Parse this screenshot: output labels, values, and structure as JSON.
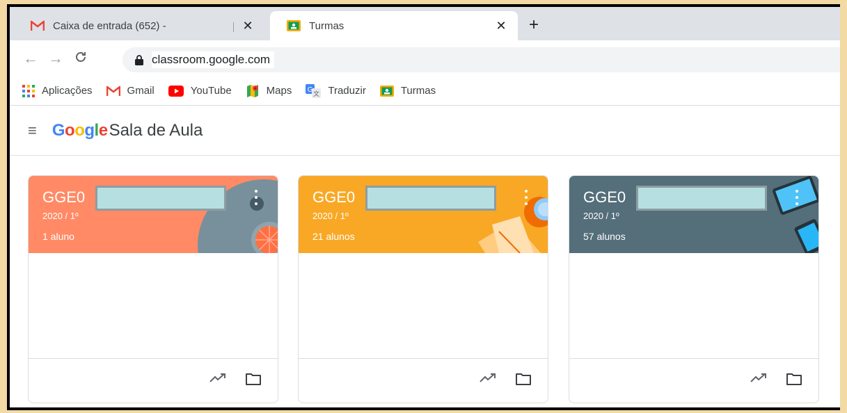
{
  "tabs": [
    {
      "title": "Caixa de entrada (652) -",
      "close": "✕",
      "favicon": "gmail-icon"
    },
    {
      "title": "Turmas",
      "close": "✕",
      "favicon": "classroom-icon"
    }
  ],
  "newtab": "+",
  "toolbar": {
    "back": "←",
    "forward": "→",
    "reload": "C",
    "url": "classroom.google.com"
  },
  "bookmarks": [
    {
      "label": "Aplicações",
      "icon": "apps-grid-icon"
    },
    {
      "label": "Gmail",
      "icon": "gmail-icon"
    },
    {
      "label": "YouTube",
      "icon": "youtube-icon"
    },
    {
      "label": "Maps",
      "icon": "maps-icon"
    },
    {
      "label": "Traduzir",
      "icon": "translate-icon"
    },
    {
      "label": "Turmas",
      "icon": "classroom-icon"
    }
  ],
  "header": {
    "menu": "≡",
    "logo": [
      {
        "ch": "G",
        "color": "#4285f4"
      },
      {
        "ch": "o",
        "color": "#ea4335"
      },
      {
        "ch": "o",
        "color": "#fbbc05"
      },
      {
        "ch": "g",
        "color": "#4285f4"
      },
      {
        "ch": "l",
        "color": "#34a853"
      },
      {
        "ch": "e",
        "color": "#ea4335"
      }
    ],
    "app_name": "Sala de Aula"
  },
  "cards": [
    {
      "name": "GGE0",
      "section": "2020 / 1º",
      "count": "1 aluno",
      "color": "#ff8a65"
    },
    {
      "name": "GGE0",
      "section": "2020 / 1º",
      "count": "21 alunos",
      "color": "#f9a825"
    },
    {
      "name": "GGE0",
      "section": "2020 / 1º",
      "count": "57 alunos",
      "color": "#546e7a"
    }
  ]
}
